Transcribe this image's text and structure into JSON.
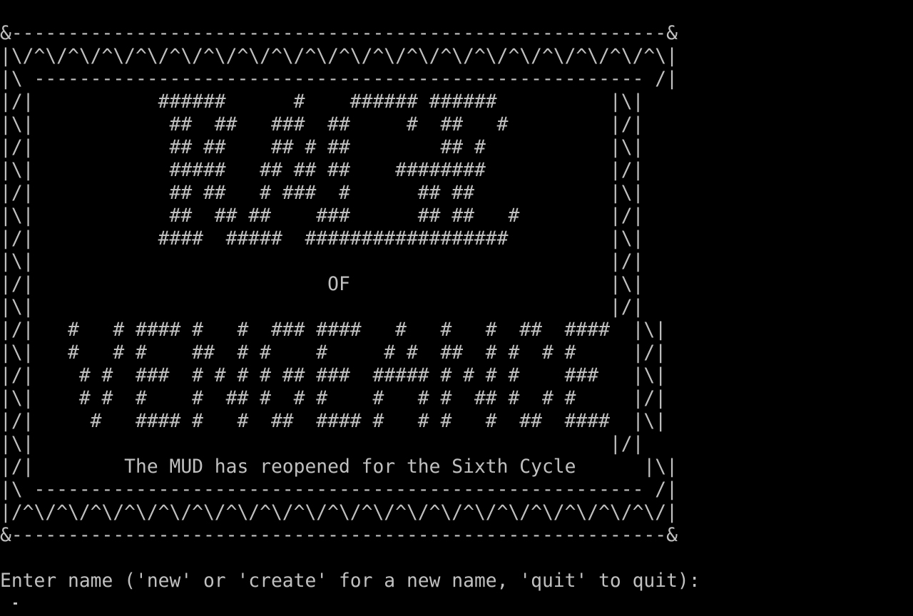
{
  "banner": {
    "lines": [
      "&----------------------------------------------------------&",
      "|\\/^\\/^\\/^\\/^\\/^\\/^\\/^\\/^\\/^\\/^\\/^\\/^\\/^\\/^\\/^\\/^\\/^\\/^\\/^\\|",
      "|\\ ------------------------------------------------------ /|",
      "|/|           ######      #    ###### ######          |\\|",
      "|\\|            ##  ##   ###  ##     #  ##   #         |/|",
      "|/|            ## ##    ## # ##        ## #           |\\|",
      "|\\|            #####   ## ## ##    ########           |/|",
      "|/|            ## ##   # ###  #      ## ##            |\\|",
      "|\\|            ##  ## ##    ###      ## ##   #        |/|",
      "|/|           ####  #####  ##################         |\\|",
      "|\\|                                                   |/|",
      "|/|                          OF                       |\\|",
      "|\\|                                                   |/|",
      "|/|   #   # #### #   #  ### ####   #   #   #  ##  ####  |\\|",
      "|\\|   #   # #    ##  # #    #     # #  ##  # #  # #     |/|",
      "|/|    # #  ###  # # # # ## ###  ##### # # # #    ###   |\\|",
      "|\\|    # #  #    #  ## #  # #    #   # #  ## #  # #     |/|",
      "|/|     #   #### #   #  ##  #### #   # #   #  ##  ####  |\\|",
      "|\\|                                                   |/|",
      "|/|        The MUD has reopened for the Sixth Cycle      |\\|",
      "|\\ ------------------------------------------------------ /|",
      "|/^\\/^\\/^\\/^\\/^\\/^\\/^\\/^\\/^\\/^\\/^\\/^\\/^\\/^\\/^\\/^\\/^\\/^\\/^\\/|",
      "&----------------------------------------------------------&"
    ]
  },
  "prompt": {
    "text": "Enter name ('new' or 'create' for a new name, 'quit' to quit):"
  },
  "colors": {
    "background": "#000000",
    "text": "#c0c0c0"
  }
}
